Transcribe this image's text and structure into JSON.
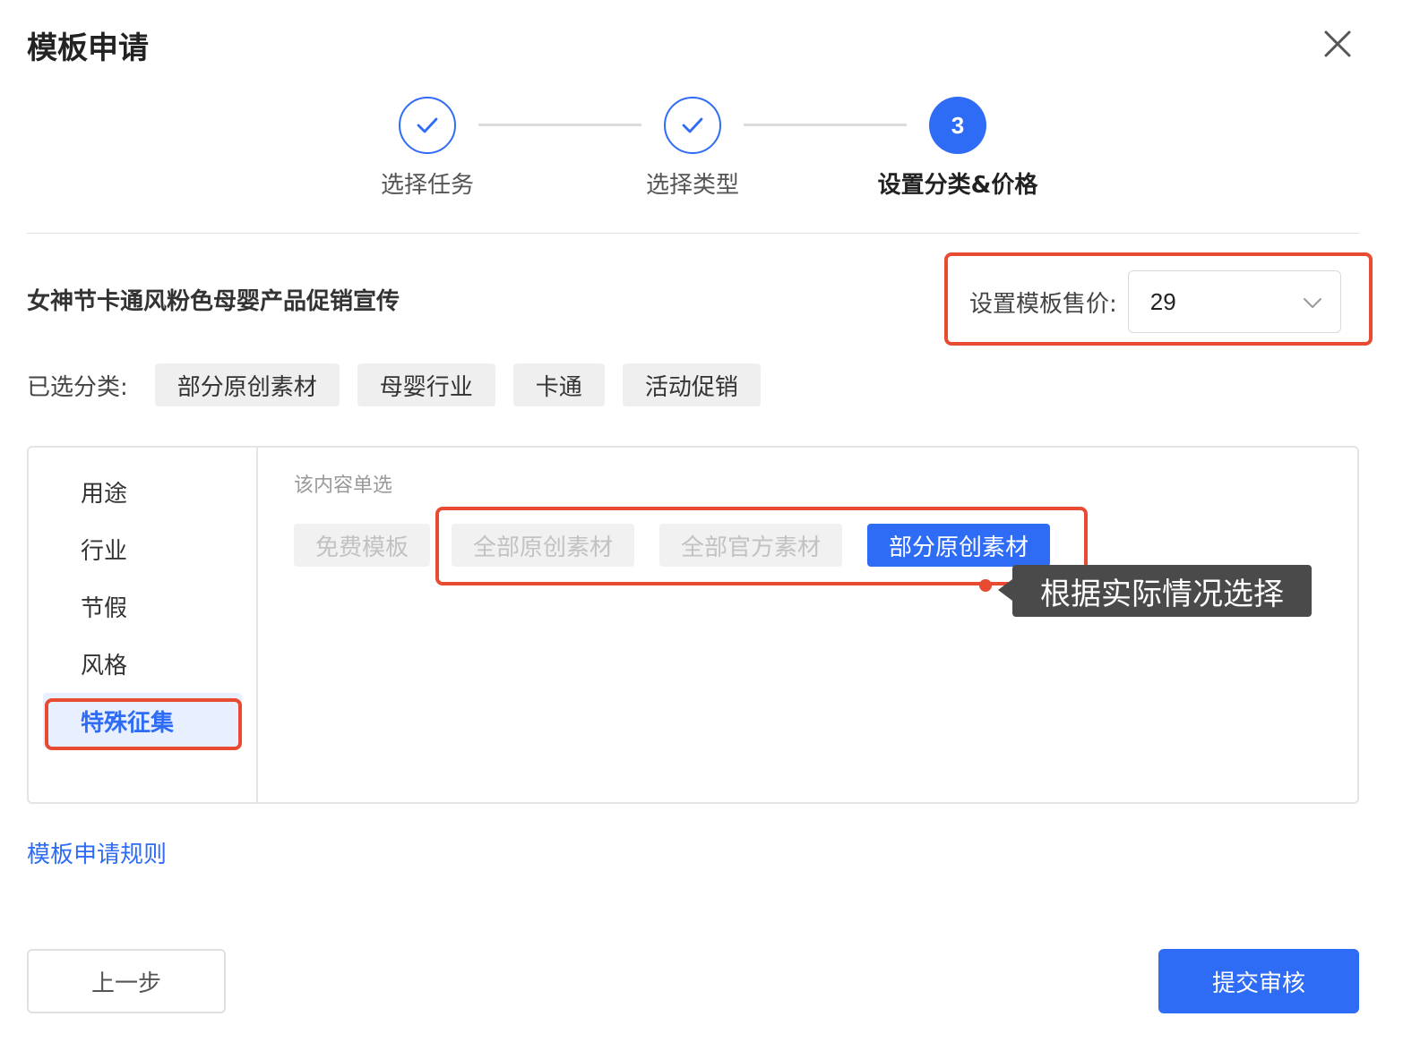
{
  "dialog": {
    "title": "模板申请",
    "close_icon": "close-icon"
  },
  "steps": [
    {
      "label": "选择任务",
      "status": "done"
    },
    {
      "label": "选择类型",
      "status": "done"
    },
    {
      "label": "设置分类&价格",
      "status": "active",
      "number": "3"
    }
  ],
  "template": {
    "name": "女神节卡通风粉色母婴产品促销宣传"
  },
  "price": {
    "label": "设置模板售价:",
    "value": "29"
  },
  "selected": {
    "label": "已选分类:",
    "tags": [
      "部分原创素材",
      "母婴行业",
      "卡通",
      "活动促销"
    ]
  },
  "categories": {
    "sidebar": [
      {
        "label": "用途",
        "active": false
      },
      {
        "label": "行业",
        "active": false
      },
      {
        "label": "节假",
        "active": false
      },
      {
        "label": "风格",
        "active": false
      },
      {
        "label": "特殊征集",
        "active": true
      }
    ],
    "hint": "该内容单选",
    "options": [
      {
        "label": "免费模板",
        "state": "disabled"
      },
      {
        "label": "全部原创素材",
        "state": "disabled"
      },
      {
        "label": "全部官方素材",
        "state": "disabled"
      },
      {
        "label": "部分原创素材",
        "state": "selected"
      }
    ]
  },
  "annotation": {
    "tooltip": "根据实际情况选择"
  },
  "footer": {
    "rules_link": "模板申请规则",
    "prev_button": "上一步",
    "submit_button": "提交审核"
  },
  "colors": {
    "primary": "#2f6cf6",
    "annotation_red": "#e84a32",
    "tooltip_bg": "#4a4a4a"
  }
}
